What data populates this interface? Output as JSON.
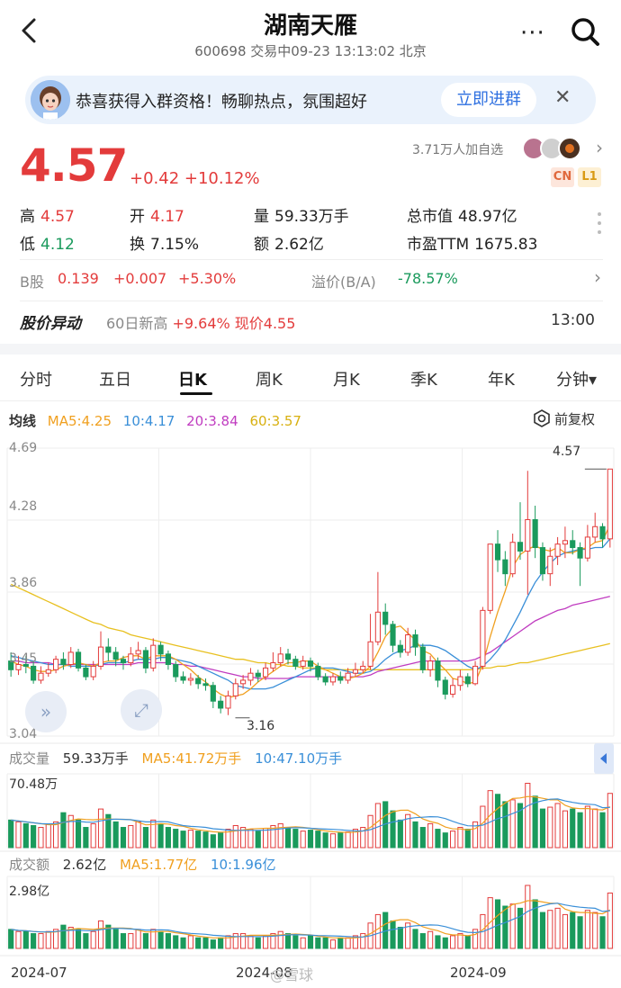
{
  "header": {
    "title": "湖南天雁",
    "subtitle": "600698 交易中09-23 13:13:02 北京"
  },
  "banner": {
    "text": "恭喜获得入群资格！畅聊热点，氛围超好",
    "button": "立即进群"
  },
  "quote": {
    "price": "4.57",
    "change": "+0.42 +10.12%",
    "followers": "3.71万人加自选",
    "tags": [
      "CN",
      "L1"
    ],
    "stats": {
      "high_label": "高",
      "high": "4.57",
      "open_label": "开",
      "open": "4.17",
      "volume_label": "量",
      "volume": "59.33万手",
      "mktcap_label": "总市值",
      "mktcap": "48.97亿",
      "low_label": "低",
      "low": "4.12",
      "turnover_label": "换",
      "turnover": "7.15%",
      "amount_label": "额",
      "amount": "2.62亿",
      "pe_label": "市盈TTM",
      "pe": "1675.83"
    },
    "bshare": {
      "label": "B股",
      "price": "0.139",
      "change": "+0.007",
      "pct": "+5.30%",
      "premium_label": "溢价(B/A)",
      "premium": "-78.57%"
    },
    "movement": {
      "title": "股价异动",
      "text_prefix": "60日新高",
      "text_value": "+9.64% 现价4.55",
      "time": "13:00"
    }
  },
  "tabs": [
    "分时",
    "五日",
    "日K",
    "周K",
    "月K",
    "季K",
    "年K",
    "分钟▾"
  ],
  "active_tab": "日K",
  "ma": {
    "label": "均线",
    "ma5": "MA5:4.25",
    "ma10": "10:4.17",
    "ma20": "20:3.84",
    "ma60": "60:3.57",
    "restore": "前复权"
  },
  "price_axis": [
    "4.69",
    "4.28",
    "3.86",
    "3.45",
    "3.04"
  ],
  "annotations": {
    "high": "4.57",
    "low": "3.16"
  },
  "volume": {
    "label": "成交量",
    "value": "59.33万手",
    "ma5": "MA5:41.72万手",
    "ma10": "10:47.10万手",
    "max": "70.48万"
  },
  "amount": {
    "label": "成交额",
    "value": "2.62亿",
    "ma5": "MA5:1.77亿",
    "ma10": "10:1.96亿",
    "max": "2.98亿"
  },
  "x_axis": [
    "2024-07",
    "2024-08",
    "2024-09"
  ],
  "watermark": "@雪球",
  "colors": {
    "up": "#e33b3b",
    "down": "#1a9a5c",
    "ma5": "#f0a020",
    "ma10": "#3a8fd8",
    "ma20": "#c03cc0",
    "ma60": "#e8c020"
  },
  "chart_data": {
    "type": "candlestick",
    "ylim": [
      3.04,
      4.69
    ],
    "candles": [
      [
        3.47,
        3.42,
        3.52,
        3.38
      ],
      [
        3.42,
        3.45,
        3.5,
        3.39
      ],
      [
        3.45,
        3.44,
        3.5,
        3.4
      ],
      [
        3.44,
        3.36,
        3.47,
        3.34
      ],
      [
        3.36,
        3.4,
        3.44,
        3.34
      ],
      [
        3.4,
        3.42,
        3.46,
        3.38
      ],
      [
        3.42,
        3.48,
        3.5,
        3.4
      ],
      [
        3.48,
        3.45,
        3.52,
        3.42
      ],
      [
        3.45,
        3.52,
        3.55,
        3.43
      ],
      [
        3.52,
        3.43,
        3.54,
        3.41
      ],
      [
        3.43,
        3.38,
        3.45,
        3.36
      ],
      [
        3.38,
        3.44,
        3.47,
        3.36
      ],
      [
        3.44,
        3.55,
        3.64,
        3.42
      ],
      [
        3.55,
        3.52,
        3.6,
        3.47
      ],
      [
        3.52,
        3.48,
        3.55,
        3.44
      ],
      [
        3.48,
        3.46,
        3.5,
        3.42
      ],
      [
        3.46,
        3.51,
        3.55,
        3.44
      ],
      [
        3.51,
        3.53,
        3.58,
        3.48
      ],
      [
        3.53,
        3.43,
        3.55,
        3.4
      ],
      [
        3.43,
        3.56,
        3.6,
        3.41
      ],
      [
        3.56,
        3.51,
        3.58,
        3.47
      ],
      [
        3.51,
        3.45,
        3.53,
        3.42
      ],
      [
        3.45,
        3.38,
        3.47,
        3.35
      ],
      [
        3.38,
        3.36,
        3.41,
        3.34
      ],
      [
        3.36,
        3.37,
        3.4,
        3.33
      ],
      [
        3.37,
        3.34,
        3.39,
        3.31
      ],
      [
        3.34,
        3.33,
        3.37,
        3.3
      ],
      [
        3.33,
        3.24,
        3.35,
        3.2
      ],
      [
        3.24,
        3.2,
        3.27,
        3.17
      ],
      [
        3.2,
        3.27,
        3.3,
        3.16
      ],
      [
        3.27,
        3.34,
        3.37,
        3.25
      ],
      [
        3.34,
        3.36,
        3.39,
        3.31
      ],
      [
        3.36,
        3.4,
        3.43,
        3.33
      ],
      [
        3.4,
        3.38,
        3.42,
        3.35
      ],
      [
        3.38,
        3.43,
        3.46,
        3.36
      ],
      [
        3.43,
        3.46,
        3.52,
        3.41
      ],
      [
        3.46,
        3.51,
        3.55,
        3.44
      ],
      [
        3.51,
        3.48,
        3.54,
        3.45
      ],
      [
        3.48,
        3.44,
        3.5,
        3.42
      ],
      [
        3.44,
        3.47,
        3.5,
        3.42
      ],
      [
        3.47,
        3.44,
        3.49,
        3.41
      ],
      [
        3.44,
        3.38,
        3.46,
        3.36
      ],
      [
        3.38,
        3.35,
        3.4,
        3.33
      ],
      [
        3.35,
        3.38,
        3.4,
        3.33
      ],
      [
        3.38,
        3.36,
        3.41,
        3.34
      ],
      [
        3.36,
        3.4,
        3.43,
        3.34
      ],
      [
        3.4,
        3.42,
        3.46,
        3.38
      ],
      [
        3.42,
        3.44,
        3.47,
        3.4
      ],
      [
        3.44,
        3.58,
        3.74,
        3.42
      ],
      [
        3.58,
        3.75,
        3.98,
        3.56
      ],
      [
        3.75,
        3.68,
        3.8,
        3.62
      ],
      [
        3.68,
        3.56,
        3.7,
        3.52
      ],
      [
        3.56,
        3.52,
        3.59,
        3.49
      ],
      [
        3.52,
        3.62,
        3.66,
        3.5
      ],
      [
        3.62,
        3.55,
        3.65,
        3.5
      ],
      [
        3.55,
        3.42,
        3.57,
        3.4
      ],
      [
        3.42,
        3.47,
        3.5,
        3.38
      ],
      [
        3.47,
        3.36,
        3.49,
        3.32
      ],
      [
        3.36,
        3.28,
        3.38,
        3.25
      ],
      [
        3.28,
        3.33,
        3.37,
        3.26
      ],
      [
        3.33,
        3.38,
        3.42,
        3.3
      ],
      [
        3.38,
        3.34,
        3.4,
        3.32
      ],
      [
        3.34,
        3.44,
        3.47,
        3.33
      ],
      [
        3.44,
        3.76,
        3.78,
        3.42
      ],
      [
        3.76,
        4.14,
        4.14,
        3.74
      ],
      [
        4.14,
        4.05,
        4.22,
        3.98
      ],
      [
        4.05,
        3.97,
        4.1,
        3.9
      ],
      [
        3.97,
        4.15,
        4.2,
        3.95
      ],
      [
        4.15,
        4.1,
        4.38,
        4.05
      ],
      [
        4.1,
        4.28,
        4.56,
        3.85
      ],
      [
        4.28,
        4.12,
        4.36,
        4.06
      ],
      [
        4.12,
        3.97,
        4.15,
        3.93
      ],
      [
        3.97,
        4.07,
        4.12,
        3.9
      ],
      [
        4.07,
        4.14,
        4.18,
        4.02
      ],
      [
        4.14,
        4.16,
        4.24,
        4.06
      ],
      [
        4.16,
        4.12,
        4.22,
        4.08
      ],
      [
        4.12,
        4.06,
        4.15,
        3.9
      ],
      [
        4.06,
        4.18,
        4.25,
        4.04
      ],
      [
        4.18,
        4.24,
        4.32,
        4.15
      ],
      [
        4.24,
        4.17,
        4.26,
        4.12
      ],
      [
        4.17,
        4.57,
        4.57,
        4.12
      ]
    ],
    "volume": [
      30,
      28,
      26,
      24,
      22,
      25,
      28,
      38,
      35,
      30,
      22,
      26,
      42,
      36,
      28,
      22,
      24,
      28,
      22,
      30,
      26,
      22,
      20,
      18,
      19,
      18,
      17,
      14,
      16,
      20,
      24,
      22,
      20,
      18,
      21,
      24,
      26,
      22,
      20,
      18,
      19,
      18,
      16,
      15,
      16,
      17,
      20,
      22,
      35,
      48,
      50,
      40,
      30,
      36,
      28,
      22,
      26,
      20,
      16,
      18,
      22,
      20,
      28,
      45,
      62,
      58,
      50,
      52,
      48,
      70,
      56,
      42,
      44,
      48,
      40,
      42,
      38,
      45,
      42,
      38,
      59
    ],
    "amount": [
      0.9,
      0.8,
      0.8,
      0.7,
      0.7,
      0.8,
      0.9,
      1.1,
      1.0,
      0.9,
      0.7,
      0.8,
      1.3,
      1.1,
      0.9,
      0.7,
      0.7,
      0.9,
      0.7,
      0.9,
      0.8,
      0.7,
      0.6,
      0.5,
      0.6,
      0.5,
      0.5,
      0.4,
      0.5,
      0.6,
      0.7,
      0.7,
      0.6,
      0.5,
      0.6,
      0.7,
      0.8,
      0.7,
      0.6,
      0.5,
      0.6,
      0.5,
      0.5,
      0.4,
      0.5,
      0.5,
      0.6,
      0.7,
      1.2,
      1.6,
      1.7,
      1.3,
      1.0,
      1.2,
      0.9,
      0.7,
      0.8,
      0.6,
      0.5,
      0.6,
      0.7,
      0.6,
      0.9,
      1.6,
      2.4,
      2.3,
      2.0,
      2.1,
      1.9,
      2.98,
      2.3,
      1.7,
      1.8,
      1.9,
      1.6,
      1.7,
      1.5,
      1.8,
      1.7,
      1.5,
      2.62
    ],
    "ma5": [
      3.47,
      3.45,
      3.44,
      3.42,
      3.41,
      3.41,
      3.42,
      3.44,
      3.45,
      3.46,
      3.45,
      3.44,
      3.46,
      3.47,
      3.47,
      3.49,
      3.5,
      3.5,
      3.48,
      3.5,
      3.5,
      3.5,
      3.48,
      3.45,
      3.42,
      3.38,
      3.35,
      3.31,
      3.28,
      3.26,
      3.27,
      3.28,
      3.31,
      3.35,
      3.38,
      3.41,
      3.44,
      3.46,
      3.46,
      3.47,
      3.47,
      3.44,
      3.42,
      3.4,
      3.38,
      3.37,
      3.38,
      3.4,
      3.44,
      3.52,
      3.61,
      3.66,
      3.67,
      3.63,
      3.59,
      3.53,
      3.51,
      3.46,
      3.42,
      3.37,
      3.36,
      3.34,
      3.35,
      3.45,
      3.61,
      3.75,
      3.87,
      4.01,
      4.08,
      4.11,
      4.13,
      4.11,
      4.1,
      4.12,
      4.09,
      4.09,
      4.11,
      4.12,
      4.15,
      4.16,
      4.25
    ],
    "ma10": [
      3.5,
      3.49,
      3.48,
      3.47,
      3.46,
      3.45,
      3.45,
      3.45,
      3.44,
      3.44,
      3.44,
      3.44,
      3.45,
      3.46,
      3.46,
      3.46,
      3.47,
      3.48,
      3.48,
      3.48,
      3.49,
      3.49,
      3.48,
      3.47,
      3.46,
      3.44,
      3.42,
      3.4,
      3.38,
      3.36,
      3.33,
      3.32,
      3.31,
      3.31,
      3.31,
      3.32,
      3.34,
      3.36,
      3.38,
      3.4,
      3.42,
      3.43,
      3.43,
      3.43,
      3.42,
      3.41,
      3.4,
      3.4,
      3.41,
      3.44,
      3.48,
      3.51,
      3.53,
      3.54,
      3.56,
      3.56,
      3.56,
      3.55,
      3.53,
      3.5,
      3.47,
      3.44,
      3.42,
      3.44,
      3.48,
      3.53,
      3.59,
      3.67,
      3.75,
      3.84,
      3.92,
      3.98,
      4.03,
      4.07,
      4.09,
      4.1,
      4.11,
      4.11,
      4.12,
      4.12,
      4.17
    ],
    "ma20": [
      3.47,
      3.47,
      3.46,
      3.46,
      3.46,
      3.46,
      3.45,
      3.45,
      3.45,
      3.45,
      3.45,
      3.45,
      3.45,
      3.45,
      3.45,
      3.45,
      3.45,
      3.46,
      3.46,
      3.46,
      3.46,
      3.46,
      3.45,
      3.45,
      3.44,
      3.44,
      3.43,
      3.42,
      3.41,
      3.4,
      3.39,
      3.38,
      3.38,
      3.37,
      3.37,
      3.37,
      3.37,
      3.37,
      3.38,
      3.38,
      3.38,
      3.38,
      3.38,
      3.38,
      3.38,
      3.38,
      3.38,
      3.38,
      3.39,
      3.41,
      3.42,
      3.43,
      3.44,
      3.45,
      3.46,
      3.47,
      3.47,
      3.47,
      3.47,
      3.47,
      3.47,
      3.47,
      3.48,
      3.5,
      3.52,
      3.55,
      3.58,
      3.61,
      3.64,
      3.67,
      3.7,
      3.72,
      3.74,
      3.76,
      3.77,
      3.79,
      3.8,
      3.81,
      3.82,
      3.83,
      3.84
    ],
    "ma60": [
      3.91,
      3.89,
      3.87,
      3.85,
      3.83,
      3.81,
      3.79,
      3.77,
      3.75,
      3.73,
      3.71,
      3.69,
      3.68,
      3.66,
      3.65,
      3.64,
      3.62,
      3.61,
      3.6,
      3.59,
      3.58,
      3.57,
      3.56,
      3.55,
      3.54,
      3.53,
      3.52,
      3.51,
      3.5,
      3.49,
      3.48,
      3.48,
      3.47,
      3.46,
      3.46,
      3.45,
      3.45,
      3.44,
      3.44,
      3.43,
      3.43,
      3.43,
      3.42,
      3.42,
      3.42,
      3.42,
      3.42,
      3.42,
      3.42,
      3.42,
      3.42,
      3.42,
      3.42,
      3.42,
      3.42,
      3.42,
      3.42,
      3.42,
      3.42,
      3.42,
      3.42,
      3.42,
      3.42,
      3.43,
      3.43,
      3.44,
      3.44,
      3.45,
      3.46,
      3.46,
      3.47,
      3.48,
      3.49,
      3.5,
      3.51,
      3.52,
      3.53,
      3.54,
      3.55,
      3.56,
      3.57
    ]
  }
}
